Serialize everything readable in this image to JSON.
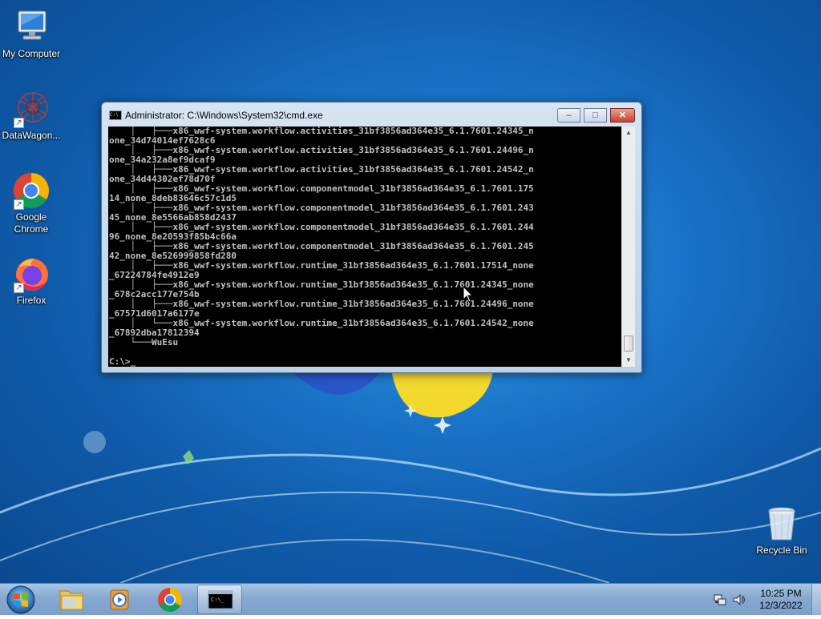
{
  "desktop": {
    "icons": [
      {
        "label": "My Computer",
        "icon": "computer-icon"
      },
      {
        "label": "DataWagon...",
        "icon": "datawagon-icon"
      },
      {
        "label": "Google Chrome",
        "icon": "chrome-icon"
      },
      {
        "label": "Firefox",
        "icon": "firefox-icon"
      },
      {
        "label": "Recycle Bin",
        "icon": "recycle-bin-icon"
      }
    ]
  },
  "cmd": {
    "title": "Administrator: C:\\Windows\\System32\\cmd.exe",
    "buttons": {
      "minimize": "–",
      "maximize": "□",
      "close": "✕"
    },
    "lines": [
      "    │   ├───x86_wwf-system.workflow.activities_31bf3856ad364e35_6.1.7601.24345_n",
      "one_34d74014ef7628c6",
      "    │   ├───x86_wwf-system.workflow.activities_31bf3856ad364e35_6.1.7601.24496_n",
      "one_34a232a8ef9dcaf9",
      "    │   ├───x86_wwf-system.workflow.activities_31bf3856ad364e35_6.1.7601.24542_n",
      "one_34d44302ef78d70f",
      "    │   ├───x86_wwf-system.workflow.componentmodel_31bf3856ad364e35_6.1.7601.175",
      "14_none_8deb83646c57c1d5",
      "    │   ├───x86_wwf-system.workflow.componentmodel_31bf3856ad364e35_6.1.7601.243",
      "45_none_8e5566ab858d2437",
      "    │   ├───x86_wwf-system.workflow.componentmodel_31bf3856ad364e35_6.1.7601.244",
      "96_none_8e20593f85b4c66a",
      "    │   ├───x86_wwf-system.workflow.componentmodel_31bf3856ad364e35_6.1.7601.245",
      "42_none_8e526999858fd280",
      "    │   ├───x86_wwf-system.workflow.runtime_31bf3856ad364e35_6.1.7601.17514_none",
      "_67224784fe4912e9",
      "    │   ├───x86_wwf-system.workflow.runtime_31bf3856ad364e35_6.1.7601.24345_none",
      "_678c2acc177e754b",
      "    │   ├───x86_wwf-system.workflow.runtime_31bf3856ad364e35_6.1.7601.24496_none",
      "_67571d6017a6177e",
      "    │   └───x86_wwf-system.workflow.runtime_31bf3856ad364e35_6.1.7601.24542_none",
      "_67892dba17812394",
      "    └───WuEsu",
      "",
      "C:\\>_"
    ]
  },
  "taskbar": {
    "items": [
      {
        "name": "start-button",
        "icon": "windows-logo-icon"
      },
      {
        "name": "explorer",
        "icon": "folder-icon"
      },
      {
        "name": "media-player",
        "icon": "media-player-icon"
      },
      {
        "name": "chrome",
        "icon": "chrome-icon"
      },
      {
        "name": "cmd",
        "icon": "cmd-icon",
        "active": true
      }
    ],
    "time": "10:25 PM",
    "date": "12/3/2022"
  },
  "colors": {
    "console_bg": "#000000",
    "console_fg": "#c0c0c0",
    "desktop_blue": "#1a74c9",
    "close_red": "#c7412a"
  }
}
